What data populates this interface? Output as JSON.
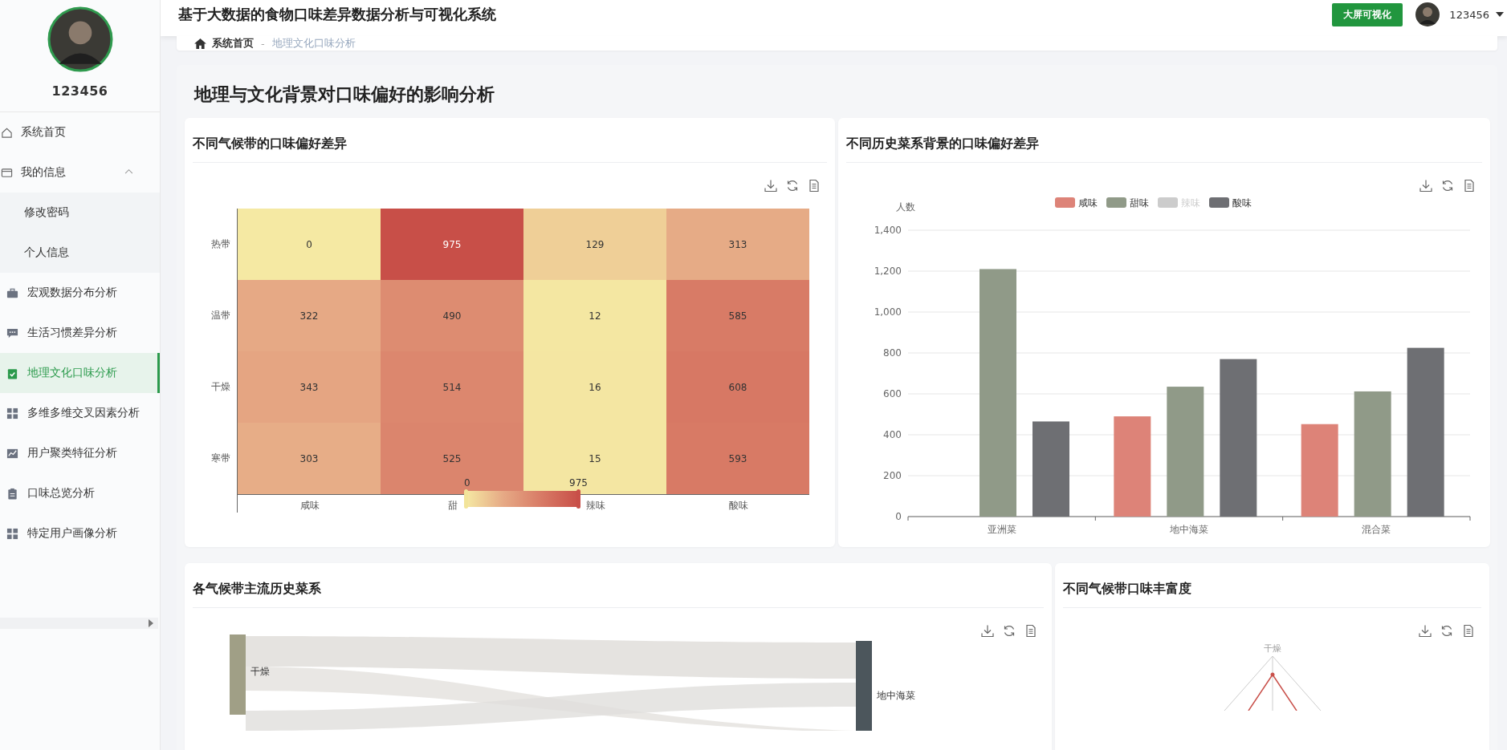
{
  "header": {
    "title": "基于大数据的食物口味差异数据分析与可视化系统",
    "screen_button": "大屏可视化",
    "username": "123456"
  },
  "sidebar": {
    "username": "123456",
    "items": [
      {
        "label": "系统首页",
        "kind": "item",
        "selected": false
      },
      {
        "label": "我的信息",
        "kind": "group",
        "expanded": true,
        "selected": false,
        "children": [
          {
            "label": "修改密码",
            "selected": false
          },
          {
            "label": "个人信息",
            "selected": false
          }
        ]
      },
      {
        "label": "宏观数据分布分析",
        "kind": "item",
        "selected": false
      },
      {
        "label": "生活习惯差异分析",
        "kind": "item",
        "selected": false
      },
      {
        "label": "地理文化口味分析",
        "kind": "item",
        "selected": true
      },
      {
        "label": "多维多维交叉因素分析",
        "kind": "item",
        "selected": false
      },
      {
        "label": "用户聚类特征分析",
        "kind": "item",
        "selected": false
      },
      {
        "label": "口味总览分析",
        "kind": "item",
        "selected": false
      },
      {
        "label": "特定用户画像分析",
        "kind": "item",
        "selected": false
      }
    ]
  },
  "breadcrumb": {
    "home": "系统首页",
    "separator": "-",
    "current": "地理文化口味分析"
  },
  "page_title": "地理与文化背景对口味偏好的影响分析",
  "heatmap_card": {
    "title": "不同气候带的口味偏好差异",
    "x_labels_shown": [
      "咸味",
      "甜",
      "辣味",
      "酸味"
    ],
    "rows": [
      {
        "label": "热带",
        "values": [
          "0",
          "975",
          "129",
          "313"
        ]
      },
      {
        "label": "温带",
        "values": [
          "322",
          "490",
          "12",
          "585"
        ]
      },
      {
        "label": "干燥",
        "values": [
          "343",
          "514",
          "16",
          "608"
        ]
      },
      {
        "label": "寒带",
        "values": [
          "303",
          "525",
          "15",
          "593"
        ]
      }
    ],
    "visual_map": {
      "min": "0",
      "max": "975",
      "level": 1
    }
  },
  "bar_card": {
    "title": "不同历史菜系背景的口味偏好差异",
    "chart_data": {
      "type": "bar",
      "ylabel": "人数",
      "categories": [
        "亚洲菜",
        "地中海菜",
        "混合菜"
      ],
      "ylim": [
        0,
        1400
      ],
      "grid": true,
      "legend": "top",
      "yticks": [
        {
          "value": 0,
          "label": "0"
        },
        {
          "value": 200,
          "label": "200"
        },
        {
          "value": 400,
          "label": "400"
        },
        {
          "value": 600,
          "label": "600"
        },
        {
          "value": 800,
          "label": "800"
        },
        {
          "value": 1000,
          "label": "1,000"
        },
        {
          "value": 1200,
          "label": "1,200"
        },
        {
          "value": 1400,
          "label": "1,400"
        }
      ],
      "series": [
        {
          "name": "咸味",
          "color": "#dd8378",
          "values": [
            null,
            490,
            452
          ]
        },
        {
          "name": "甜味",
          "color": "#909a88",
          "values": [
            1210,
            635,
            612
          ]
        },
        {
          "name": "辣味",
          "values": [
            null,
            null,
            null
          ]
        },
        {
          "name": "酸味",
          "color": "#6e6f73",
          "values": [
            465,
            770,
            825
          ]
        }
      ]
    },
    "legend_states": [
      {
        "selected": true
      },
      {
        "selected": true
      },
      {
        "selected": false
      },
      {
        "selected": true
      }
    ]
  },
  "sankey_card": {
    "title": "各气候带主流历史菜系",
    "nodes": [
      {
        "label": "干燥",
        "color": "#a09f86"
      },
      {
        "label": "地中海菜",
        "color": "#4c565c"
      }
    ]
  },
  "radar_card": {
    "title": "不同气候带口味丰富度",
    "axis_label": "干燥"
  }
}
